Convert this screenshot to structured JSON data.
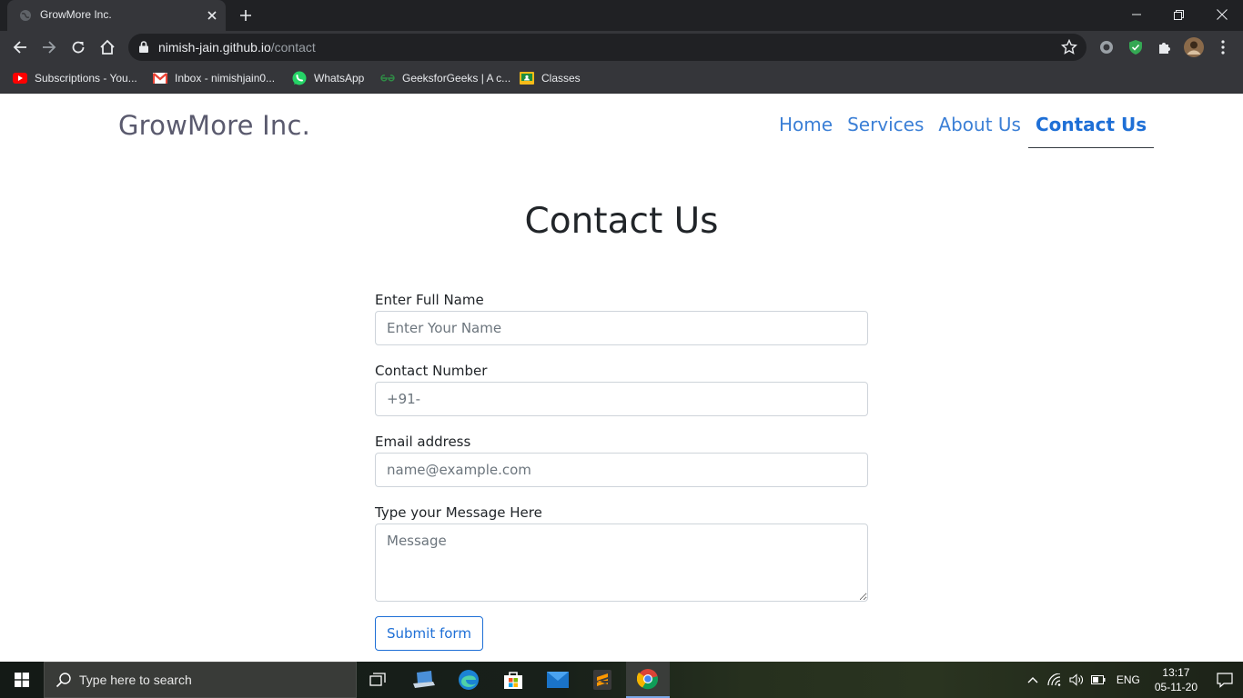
{
  "browser": {
    "tab_title": "GrowMore Inc.",
    "url_host": "nimish-jain.github.io",
    "url_path": "/contact",
    "bookmarks": [
      {
        "label": "Subscriptions - You...",
        "icon": "youtube-icon"
      },
      {
        "label": "Inbox - nimishjain0...",
        "icon": "gmail-icon"
      },
      {
        "label": "WhatsApp",
        "icon": "whatsapp-icon"
      },
      {
        "label": "GeeksforGeeks | A c...",
        "icon": "geeksforgeeks-icon"
      },
      {
        "label": "Classes",
        "icon": "classroom-icon"
      }
    ]
  },
  "site": {
    "brand": "GrowMore Inc.",
    "nav": [
      {
        "label": "Home",
        "active": false
      },
      {
        "label": "Services",
        "active": false
      },
      {
        "label": "About Us",
        "active": false
      },
      {
        "label": "Contact Us",
        "active": true
      }
    ],
    "heading": "Contact Us",
    "form": {
      "name_label": "Enter Full Name",
      "name_placeholder": "Enter Your Name",
      "phone_label": "Contact Number",
      "phone_placeholder": "+91-",
      "email_label": "Email address",
      "email_placeholder": "name@example.com",
      "message_label": "Type your Message Here",
      "message_placeholder": "Message",
      "submit_label": "Submit form"
    }
  },
  "taskbar": {
    "search_placeholder": "Type here to search",
    "language": "ENG",
    "time": "13:17",
    "date": "05-11-20"
  },
  "colors": {
    "accent": "#1e6fd6",
    "link": "#3b7fd6",
    "browser_dark": "#202124",
    "toolbar": "#35363a"
  }
}
